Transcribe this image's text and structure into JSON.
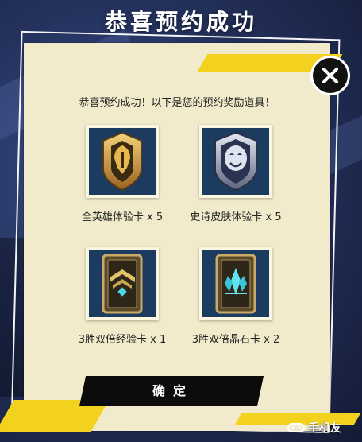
{
  "title": "恭喜预约成功",
  "message": "恭喜预约成功！以下是您的预约奖励道具！",
  "rewards": [
    {
      "label": "全英雄体验卡 x 5",
      "icon": "hero-trial-card-icon"
    },
    {
      "label": "史诗皮肤体验卡 x 5",
      "icon": "epic-skin-trial-card-icon"
    },
    {
      "label": "3胜双倍经验卡 x 1",
      "icon": "double-exp-card-icon"
    },
    {
      "label": "3胜双倍晶石卡 x 2",
      "icon": "double-crystal-card-icon"
    }
  ],
  "confirm_label": "确定",
  "watermark": "手机友",
  "colors": {
    "panel": "#f1ebcb",
    "accent_yellow": "#f3d21f",
    "button": "#0c0c0c",
    "icon_bg": "#1b3b5f"
  }
}
